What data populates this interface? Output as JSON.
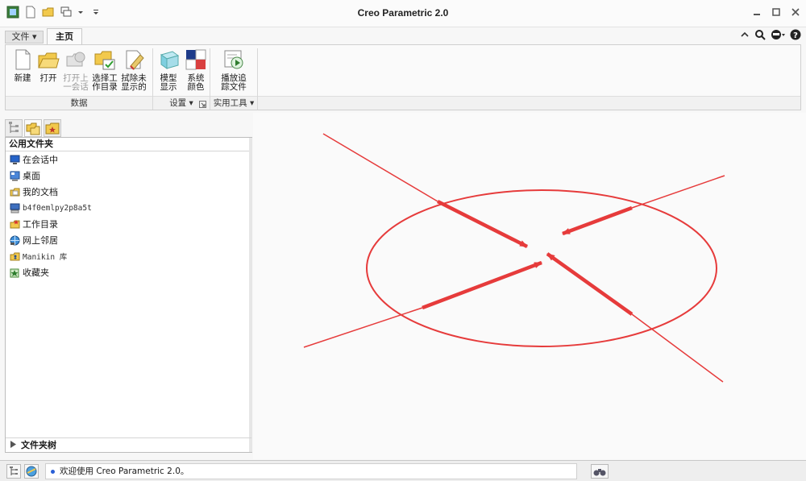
{
  "app": {
    "title": "Creo Parametric 2.0"
  },
  "ribbon": {
    "file_tab": "文件",
    "home_tab": "主页",
    "buttons": {
      "new": "新建",
      "open": "打开",
      "open_last_line1": "打开上",
      "open_last_line2": "一会话",
      "select_wd_line1": "选择工",
      "select_wd_line2": "作目录",
      "erase_line1": "拭除未",
      "erase_line2": "显示的",
      "model_display_line1": "模型",
      "model_display_line2": "显示",
      "system_colors_line1": "系统",
      "system_colors_line2": "颜色",
      "playback_line1": "播放追",
      "playback_line2": "踪文件"
    },
    "groups": {
      "data": "数据",
      "settings": "设置",
      "utilities": "实用工具"
    }
  },
  "navigator": {
    "header": "公用文件夹",
    "items": [
      {
        "label": "在会话中",
        "icon": "monitor-icon"
      },
      {
        "label": "桌面",
        "icon": "desktop-icon"
      },
      {
        "label": "我的文档",
        "icon": "documents-folder-icon"
      },
      {
        "label": "b4f0emlpy2p8a5t",
        "icon": "computer-icon"
      },
      {
        "label": "工作目录",
        "icon": "working-directory-icon"
      },
      {
        "label": "网上邻居",
        "icon": "network-icon"
      },
      {
        "label": "Manikin 库",
        "icon": "manikin-library-icon"
      },
      {
        "label": "收藏夹",
        "icon": "favorites-icon"
      }
    ],
    "footer": "文件夹树"
  },
  "status": {
    "message": "欢迎使用 Creo Parametric 2.0。"
  },
  "colors": {
    "annotation_red": "#e63b3b",
    "ribbon_bg": "#fafafa"
  }
}
